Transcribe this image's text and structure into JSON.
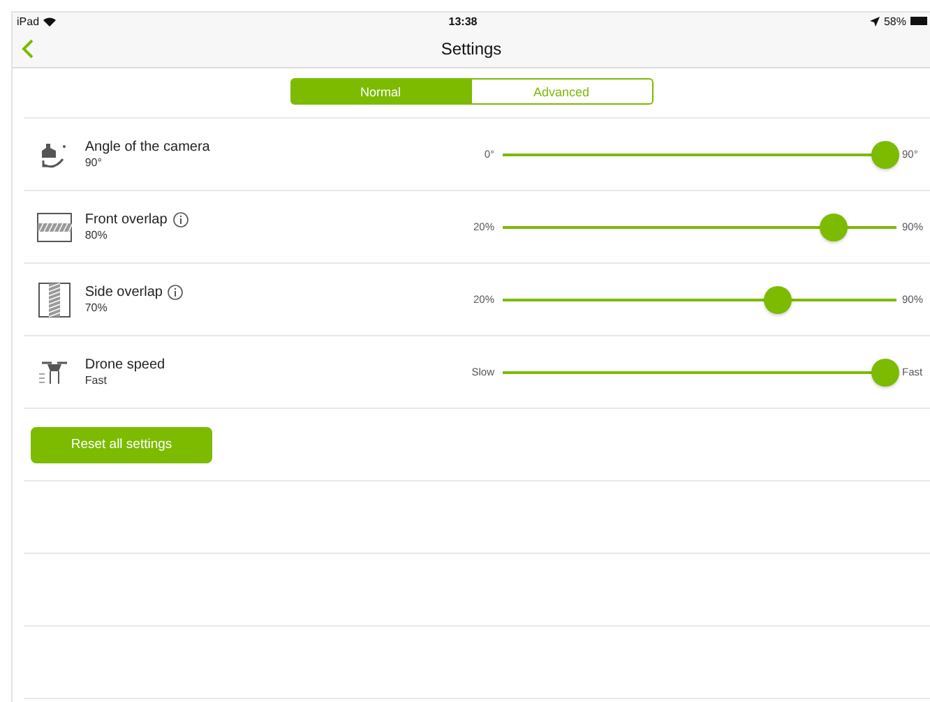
{
  "status_bar": {
    "device": "iPad",
    "time": "13:38",
    "battery": "58%"
  },
  "nav": {
    "title": "Settings"
  },
  "segments": [
    {
      "label": "Normal",
      "selected": true
    },
    {
      "label": "Advanced",
      "selected": false
    }
  ],
  "settings": [
    {
      "kind": "camera",
      "name": "Angle of the camera",
      "value": "90°",
      "info": false,
      "min": "0°",
      "max": "90°",
      "level": 0.97
    },
    {
      "kind": "front",
      "name": "Front overlap",
      "value": "80%",
      "info": true,
      "min": "20%",
      "max": "90%",
      "level": 0.84
    },
    {
      "kind": "side",
      "name": "Side overlap",
      "value": "70%",
      "info": true,
      "min": "20%",
      "max": "90%",
      "level": 0.7
    },
    {
      "kind": "drone",
      "name": "Drone speed",
      "value": "Fast",
      "info": false,
      "min": "Slow",
      "max": "Fast",
      "level": 0.97
    }
  ],
  "reset_button": "Reset all settings"
}
